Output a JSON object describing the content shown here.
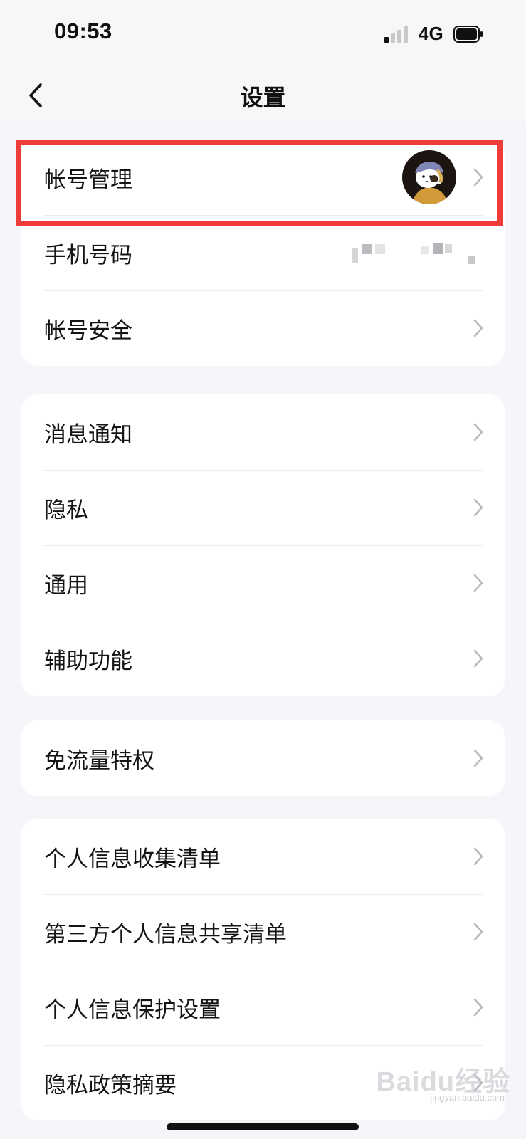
{
  "status_bar": {
    "time": "09:53",
    "network": "4G",
    "signal_bars_active": 1,
    "signal_bars_total": 4,
    "battery_icon": "battery-full-icon"
  },
  "nav": {
    "title": "设置",
    "back_icon": "chevron-left-icon"
  },
  "groups": [
    {
      "items": [
        {
          "label": "帐号管理",
          "accessory": "avatar",
          "highlighted": true
        },
        {
          "label": "手机号码",
          "accessory": "masked-value"
        },
        {
          "label": "帐号安全",
          "accessory": "chevron"
        }
      ]
    },
    {
      "items": [
        {
          "label": "消息通知",
          "accessory": "chevron"
        },
        {
          "label": "隐私",
          "accessory": "chevron"
        },
        {
          "label": "通用",
          "accessory": "chevron"
        },
        {
          "label": "辅助功能",
          "accessory": "chevron"
        }
      ]
    },
    {
      "items": [
        {
          "label": "免流量特权",
          "accessory": "chevron"
        }
      ]
    },
    {
      "items": [
        {
          "label": "个人信息收集清单",
          "accessory": "chevron"
        },
        {
          "label": "第三方个人信息共享清单",
          "accessory": "chevron"
        },
        {
          "label": "个人信息保护设置",
          "accessory": "chevron"
        },
        {
          "label": "隐私政策摘要",
          "accessory": "chevron"
        }
      ]
    }
  ],
  "colors": {
    "highlight": "#f03b3b",
    "background": "#f5f6f9",
    "chevron": "#b9b9be"
  },
  "watermark": {
    "text": "Baidu经验",
    "sub": "jingyan.baidu.com"
  }
}
